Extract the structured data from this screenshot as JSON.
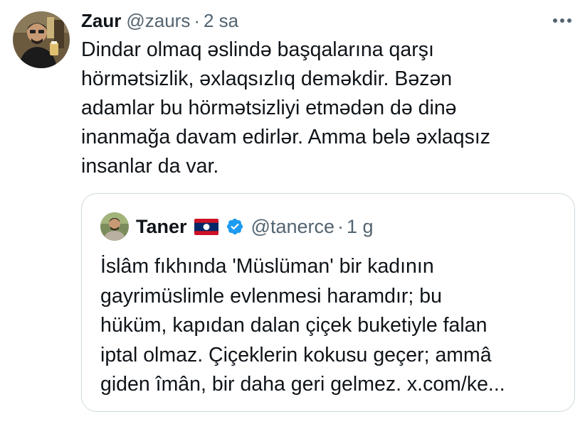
{
  "tweet": {
    "author_name": "Zaur",
    "author_handle": "@zaurs",
    "separator": "·",
    "time": "2 sa",
    "text": "Dindar olmaq əslində başqalarına qarşı\nhörmətsizlik, əxlaqsızlıq deməkdir. Bəzən\nadamlar bu hörmətsizliyi etmədən də dinə\ninanmağa davam edirlər. Amma belə əxlaqsız\ninsanlar da var."
  },
  "quote": {
    "author_name": "Taner",
    "author_handle": "@tanerce",
    "separator": "·",
    "time": "1 g",
    "text": "İslâm fıkhında 'Müslüman' bir kadının\ngayrimüslimle evlenmesi haramdır; bu\nhüküm, kapıdan dalan çiçek buketiyle falan\niptal olmaz. Çiçeklerin kokusu geçer; ammâ\ngiden îmân, bir daha geri gelmez. x.com/ke..."
  },
  "icons": {
    "more": "more-horizontal-icon",
    "flag": "laos-flag-icon",
    "verified": "verified-badge-icon"
  },
  "colors": {
    "text_primary": "#0f1419",
    "text_secondary": "#536471",
    "border": "#cfd9de",
    "verified_blue": "#1d9bf0"
  }
}
